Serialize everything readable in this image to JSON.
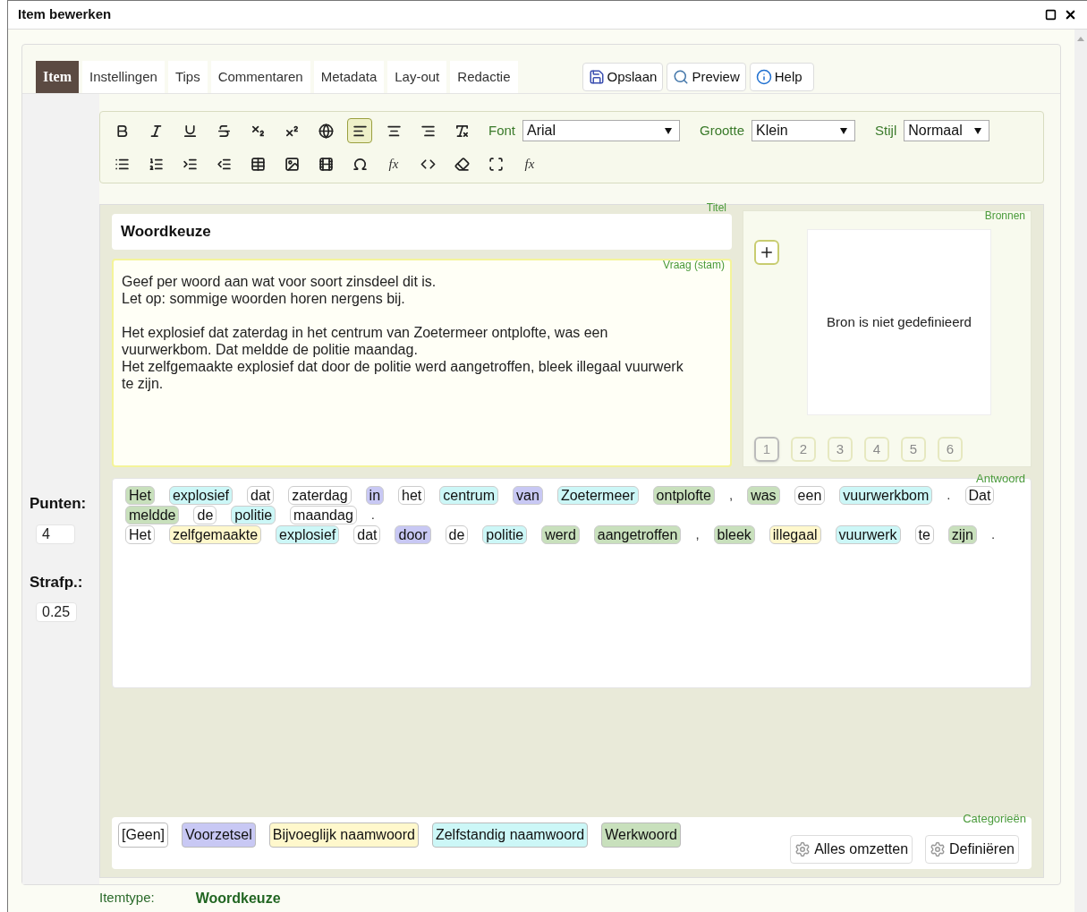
{
  "window": {
    "title": "Item bewerken"
  },
  "tabs": [
    {
      "label": "Item",
      "selected": true
    },
    {
      "label": "Instellingen",
      "selected": false
    },
    {
      "label": "Tips",
      "selected": false
    },
    {
      "label": "Commentaren",
      "selected": false
    },
    {
      "label": "Metadata",
      "selected": false
    },
    {
      "label": "Lay-out",
      "selected": false
    },
    {
      "label": "Redactie",
      "selected": false
    }
  ],
  "actions": [
    {
      "kind": "save",
      "label": "Opslaan"
    },
    {
      "kind": "preview",
      "label": "Preview"
    },
    {
      "kind": "help",
      "label": "Help"
    }
  ],
  "toolbar": {
    "row_1": [
      {
        "kind": "bold",
        "selected": false
      },
      {
        "kind": "italic",
        "selected": false
      },
      {
        "kind": "underline",
        "selected": false
      },
      {
        "kind": "strike",
        "selected": false
      },
      {
        "kind": "subscript",
        "selected": false
      },
      {
        "kind": "superscript",
        "selected": false
      },
      {
        "kind": "globe",
        "selected": false
      },
      {
        "kind": "align-left",
        "selected": true
      },
      {
        "kind": "align-center",
        "selected": false
      },
      {
        "kind": "align-right",
        "selected": false
      },
      {
        "kind": "clear-format",
        "selected": false
      }
    ],
    "font": {
      "label": "Font",
      "value": "Arial"
    },
    "size": {
      "label": "Grootte",
      "value": "Klein"
    },
    "style": {
      "label": "Stijl",
      "value": "Normaal"
    },
    "row_2": [
      {
        "kind": "bullets"
      },
      {
        "kind": "numbers"
      },
      {
        "kind": "indent"
      },
      {
        "kind": "outdent"
      },
      {
        "kind": "table"
      },
      {
        "kind": "image"
      },
      {
        "kind": "film"
      },
      {
        "kind": "omega"
      },
      {
        "kind": "formula",
        "label": "fx"
      },
      {
        "kind": "code"
      },
      {
        "kind": "eraser"
      },
      {
        "kind": "frame"
      },
      {
        "kind": "formula",
        "label": "fx"
      }
    ]
  },
  "scores": [
    {
      "label": "Punten:",
      "value": "4"
    },
    {
      "label": "Strafp.:",
      "value": "0.25"
    }
  ],
  "title_field": {
    "label": "Titel",
    "value": "Woordkeuze"
  },
  "question": {
    "label": "Vraag (stam)",
    "paragraphs": [
      "Geef per woord aan wat voor soort zinsdeel dit is.\nLet op: sommige woorden horen nergens bij.",
      "Het explosief dat zaterdag in het centrum van Zoetermeer ontplofte, was een vuurwerkbom. Dat meldde de politie maandag.\nHet zelfgemaakte explosief dat door de politie werd aangetroffen, bleek illegaal vuurwerk te zijn."
    ]
  },
  "sources": {
    "label": "Bronnen",
    "empty_text": "Bron is niet gedefinieerd",
    "pages": [
      {
        "label": "1",
        "selected": true
      },
      {
        "label": "2",
        "selected": false
      },
      {
        "label": "3",
        "selected": false
      },
      {
        "label": "4",
        "selected": false
      },
      {
        "label": "5",
        "selected": false
      },
      {
        "label": "6",
        "selected": false
      }
    ]
  },
  "answer": {
    "label": "Antwoord",
    "lines": [
      [
        {
          "kind": "word",
          "text": "Het",
          "color": "#c8e0bc"
        },
        {
          "kind": "word",
          "text": "explosief",
          "color": "#ccf7f7"
        },
        {
          "kind": "word",
          "text": "dat",
          "color": "#ffffff"
        },
        {
          "kind": "word",
          "text": "zaterdag",
          "color": "#ffffff"
        },
        {
          "kind": "word",
          "text": "in",
          "color": "#c8c8f4"
        },
        {
          "kind": "word",
          "text": "het",
          "color": "#ffffff"
        },
        {
          "kind": "word",
          "text": "centrum",
          "color": "#ccf7f7"
        },
        {
          "kind": "word",
          "text": "van",
          "color": "#c8c8f4"
        },
        {
          "kind": "word",
          "text": "Zoetermeer",
          "color": "#ccf7f7"
        },
        {
          "kind": "word",
          "text": "ontplofte",
          "color": "#c8e0bc"
        },
        {
          "kind": "punct",
          "text": ","
        },
        {
          "kind": "word",
          "text": "was",
          "color": "#c8e0bc"
        },
        {
          "kind": "word",
          "text": "een",
          "color": "#ffffff"
        },
        {
          "kind": "word",
          "text": "vuurwerkbom",
          "color": "#ccf7f7"
        },
        {
          "kind": "punct",
          "text": "."
        },
        {
          "kind": "word",
          "text": "Dat",
          "color": "#ffffff"
        }
      ],
      [
        {
          "kind": "word",
          "text": "meldde",
          "color": "#c8e0bc"
        },
        {
          "kind": "word",
          "text": "de",
          "color": "#ffffff"
        },
        {
          "kind": "word",
          "text": "politie",
          "color": "#ccf7f7"
        },
        {
          "kind": "word",
          "text": "maandag",
          "color": "#ffffff"
        },
        {
          "kind": "punct",
          "text": "."
        }
      ],
      [
        {
          "kind": "word",
          "text": "Het",
          "color": "#ffffff"
        },
        {
          "kind": "word",
          "text": "zelfgemaakte",
          "color": "#fff8cc"
        },
        {
          "kind": "word",
          "text": "explosief",
          "color": "#ccf7f7"
        },
        {
          "kind": "word",
          "text": "dat",
          "color": "#ffffff"
        },
        {
          "kind": "word",
          "text": "door",
          "color": "#c8c8f4"
        },
        {
          "kind": "word",
          "text": "de",
          "color": "#ffffff"
        },
        {
          "kind": "word",
          "text": "politie",
          "color": "#ccf7f7"
        },
        {
          "kind": "word",
          "text": "werd",
          "color": "#c8e0bc"
        },
        {
          "kind": "word",
          "text": "aangetroffen",
          "color": "#c8e0bc"
        },
        {
          "kind": "punct",
          "text": ","
        },
        {
          "kind": "word",
          "text": "bleek",
          "color": "#c8e0bc"
        },
        {
          "kind": "word",
          "text": "illegaal",
          "color": "#fff8cc"
        },
        {
          "kind": "word",
          "text": "vuurwerk",
          "color": "#ccf7f7"
        },
        {
          "kind": "word",
          "text": "te",
          "color": "#ffffff"
        },
        {
          "kind": "word",
          "text": "zijn",
          "color": "#c8e0bc"
        },
        {
          "kind": "punct",
          "text": "."
        }
      ]
    ]
  },
  "categories": {
    "label": "Categorieën",
    "items": [
      {
        "label": "[Geen]",
        "color": "#ffffff"
      },
      {
        "label": "Voorzetsel",
        "color": "#c8c8f4"
      },
      {
        "label": "Bijvoeglijk naamwoord",
        "color": "#fff8cc"
      },
      {
        "label": "Zelfstandig naamwoord",
        "color": "#ccf7f7"
      },
      {
        "label": "Werkwoord",
        "color": "#c8e0bc"
      }
    ],
    "buttons": [
      "Alles omzetten",
      "Definiëren"
    ]
  },
  "footer": {
    "label": "Itemtype:",
    "value": "Woordkeuze"
  }
}
